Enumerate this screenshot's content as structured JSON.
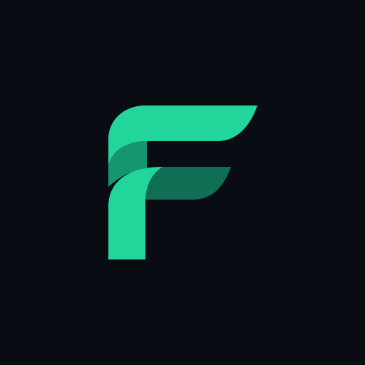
{
  "logo": {
    "letter": "F",
    "icon": "f-monogram-logo",
    "colors": {
      "background": "#090C13",
      "primary": "#22D69B",
      "shade": "#159570",
      "deep": "#0F6E53"
    }
  }
}
